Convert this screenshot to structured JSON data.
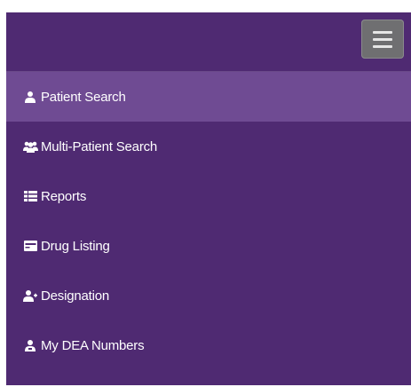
{
  "nav": {
    "toggle_icon": "hamburger-menu-icon",
    "items": [
      {
        "label": "Patient Search",
        "icon": "user-icon",
        "active": true
      },
      {
        "label": "Multi-Patient Search",
        "icon": "users-icon",
        "active": false
      },
      {
        "label": "Reports",
        "icon": "list-icon",
        "active": false
      },
      {
        "label": "Drug Listing",
        "icon": "card-icon",
        "active": false
      },
      {
        "label": "Designation",
        "icon": "user-plus-icon",
        "active": false
      },
      {
        "label": "My DEA Numbers",
        "icon": "user-badge-icon",
        "active": false
      }
    ]
  },
  "colors": {
    "background": "#4f2a72",
    "active_item": "#6f4b93",
    "toggle_button": "#6f6f71",
    "text": "#ffffff"
  }
}
